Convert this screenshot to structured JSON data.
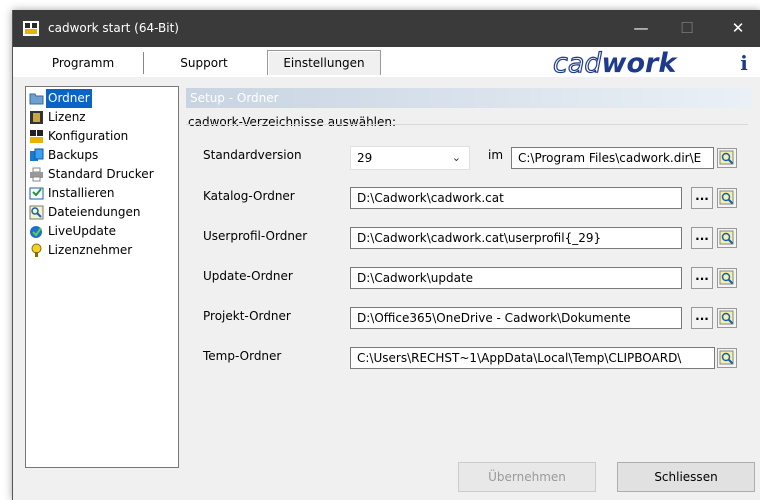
{
  "window": {
    "title": "cadwork start (64-Bit)"
  },
  "tabs": [
    "Programm",
    "Support",
    "Einstellungen"
  ],
  "logo": {
    "text_outline": "cad",
    "text_bold": "work"
  },
  "sidebar": {
    "items": [
      {
        "label": "Ordner",
        "icon": "folder-icon",
        "selected": true
      },
      {
        "label": "Lizenz",
        "icon": "license-icon"
      },
      {
        "label": "Konfiguration",
        "icon": "configuration-icon"
      },
      {
        "label": "Backups",
        "icon": "backups-icon"
      },
      {
        "label": "Standard Drucker",
        "icon": "printer-icon"
      },
      {
        "label": "Installieren",
        "icon": "install-icon"
      },
      {
        "label": "Dateiendungen",
        "icon": "file-extensions-icon"
      },
      {
        "label": "LiveUpdate",
        "icon": "liveupdate-icon"
      },
      {
        "label": "Lizenznehmer",
        "icon": "licensee-icon"
      }
    ]
  },
  "panel": {
    "header": "Setup - Ordner",
    "group_title": "cadwork-Verzeichnisse auswählen:",
    "standardversion": {
      "label": "Standardversion",
      "value": "29",
      "im_label": "im",
      "path": "C:\\Program Files\\cadwork.dir\\E"
    },
    "rows": [
      {
        "label": "Katalog-Ordner",
        "value": "D:\\Cadwork\\cadwork.cat",
        "dots": "..."
      },
      {
        "label": "Userprofil-Ordner",
        "value": "D:\\Cadwork\\cadwork.cat\\userprofil{_29}",
        "dots": "..."
      },
      {
        "label": "Update-Ordner",
        "value": "D:\\Cadwork\\update",
        "dots": "..."
      },
      {
        "label": "Projekt-Ordner",
        "value": "D:\\Office365\\OneDrive - Cadwork\\Dokumente",
        "dots": "..."
      },
      {
        "label": "Temp-Ordner",
        "value": "C:\\Users\\RECHST~1\\AppData\\Local\\Temp\\CLIPBOARD\\"
      }
    ]
  },
  "buttons": {
    "apply": "Übernehmen",
    "close": "Schliessen"
  },
  "colors": {
    "titlebar": "#3a3a3a",
    "selection": "#0a64c8",
    "logo": "#1d3a8c"
  }
}
